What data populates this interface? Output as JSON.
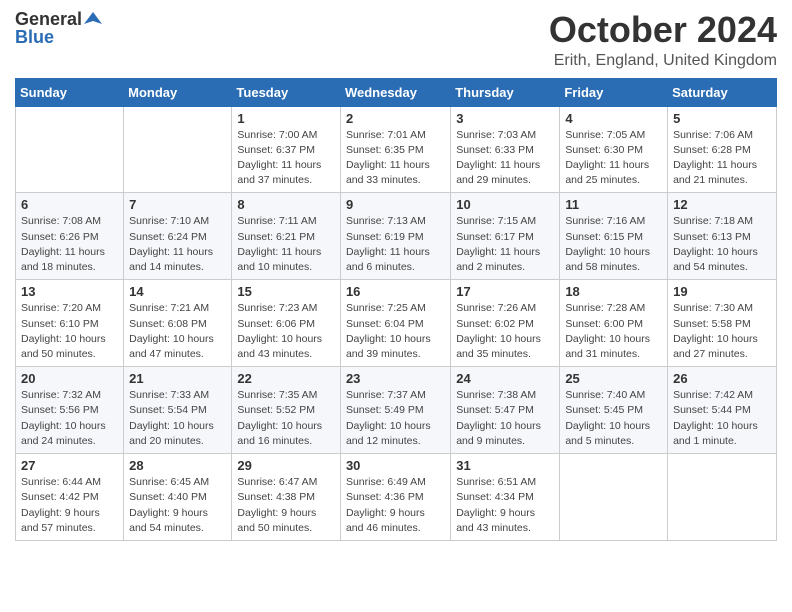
{
  "header": {
    "logo_general": "General",
    "logo_blue": "Blue",
    "month": "October 2024",
    "location": "Erith, England, United Kingdom"
  },
  "weekdays": [
    "Sunday",
    "Monday",
    "Tuesday",
    "Wednesday",
    "Thursday",
    "Friday",
    "Saturday"
  ],
  "weeks": [
    [
      {
        "day": "",
        "info": ""
      },
      {
        "day": "",
        "info": ""
      },
      {
        "day": "1",
        "info": "Sunrise: 7:00 AM\nSunset: 6:37 PM\nDaylight: 11 hours\nand 37 minutes."
      },
      {
        "day": "2",
        "info": "Sunrise: 7:01 AM\nSunset: 6:35 PM\nDaylight: 11 hours\nand 33 minutes."
      },
      {
        "day": "3",
        "info": "Sunrise: 7:03 AM\nSunset: 6:33 PM\nDaylight: 11 hours\nand 29 minutes."
      },
      {
        "day": "4",
        "info": "Sunrise: 7:05 AM\nSunset: 6:30 PM\nDaylight: 11 hours\nand 25 minutes."
      },
      {
        "day": "5",
        "info": "Sunrise: 7:06 AM\nSunset: 6:28 PM\nDaylight: 11 hours\nand 21 minutes."
      }
    ],
    [
      {
        "day": "6",
        "info": "Sunrise: 7:08 AM\nSunset: 6:26 PM\nDaylight: 11 hours\nand 18 minutes."
      },
      {
        "day": "7",
        "info": "Sunrise: 7:10 AM\nSunset: 6:24 PM\nDaylight: 11 hours\nand 14 minutes."
      },
      {
        "day": "8",
        "info": "Sunrise: 7:11 AM\nSunset: 6:21 PM\nDaylight: 11 hours\nand 10 minutes."
      },
      {
        "day": "9",
        "info": "Sunrise: 7:13 AM\nSunset: 6:19 PM\nDaylight: 11 hours\nand 6 minutes."
      },
      {
        "day": "10",
        "info": "Sunrise: 7:15 AM\nSunset: 6:17 PM\nDaylight: 11 hours\nand 2 minutes."
      },
      {
        "day": "11",
        "info": "Sunrise: 7:16 AM\nSunset: 6:15 PM\nDaylight: 10 hours\nand 58 minutes."
      },
      {
        "day": "12",
        "info": "Sunrise: 7:18 AM\nSunset: 6:13 PM\nDaylight: 10 hours\nand 54 minutes."
      }
    ],
    [
      {
        "day": "13",
        "info": "Sunrise: 7:20 AM\nSunset: 6:10 PM\nDaylight: 10 hours\nand 50 minutes."
      },
      {
        "day": "14",
        "info": "Sunrise: 7:21 AM\nSunset: 6:08 PM\nDaylight: 10 hours\nand 47 minutes."
      },
      {
        "day": "15",
        "info": "Sunrise: 7:23 AM\nSunset: 6:06 PM\nDaylight: 10 hours\nand 43 minutes."
      },
      {
        "day": "16",
        "info": "Sunrise: 7:25 AM\nSunset: 6:04 PM\nDaylight: 10 hours\nand 39 minutes."
      },
      {
        "day": "17",
        "info": "Sunrise: 7:26 AM\nSunset: 6:02 PM\nDaylight: 10 hours\nand 35 minutes."
      },
      {
        "day": "18",
        "info": "Sunrise: 7:28 AM\nSunset: 6:00 PM\nDaylight: 10 hours\nand 31 minutes."
      },
      {
        "day": "19",
        "info": "Sunrise: 7:30 AM\nSunset: 5:58 PM\nDaylight: 10 hours\nand 27 minutes."
      }
    ],
    [
      {
        "day": "20",
        "info": "Sunrise: 7:32 AM\nSunset: 5:56 PM\nDaylight: 10 hours\nand 24 minutes."
      },
      {
        "day": "21",
        "info": "Sunrise: 7:33 AM\nSunset: 5:54 PM\nDaylight: 10 hours\nand 20 minutes."
      },
      {
        "day": "22",
        "info": "Sunrise: 7:35 AM\nSunset: 5:52 PM\nDaylight: 10 hours\nand 16 minutes."
      },
      {
        "day": "23",
        "info": "Sunrise: 7:37 AM\nSunset: 5:49 PM\nDaylight: 10 hours\nand 12 minutes."
      },
      {
        "day": "24",
        "info": "Sunrise: 7:38 AM\nSunset: 5:47 PM\nDaylight: 10 hours\nand 9 minutes."
      },
      {
        "day": "25",
        "info": "Sunrise: 7:40 AM\nSunset: 5:45 PM\nDaylight: 10 hours\nand 5 minutes."
      },
      {
        "day": "26",
        "info": "Sunrise: 7:42 AM\nSunset: 5:44 PM\nDaylight: 10 hours\nand 1 minute."
      }
    ],
    [
      {
        "day": "27",
        "info": "Sunrise: 6:44 AM\nSunset: 4:42 PM\nDaylight: 9 hours\nand 57 minutes."
      },
      {
        "day": "28",
        "info": "Sunrise: 6:45 AM\nSunset: 4:40 PM\nDaylight: 9 hours\nand 54 minutes."
      },
      {
        "day": "29",
        "info": "Sunrise: 6:47 AM\nSunset: 4:38 PM\nDaylight: 9 hours\nand 50 minutes."
      },
      {
        "day": "30",
        "info": "Sunrise: 6:49 AM\nSunset: 4:36 PM\nDaylight: 9 hours\nand 46 minutes."
      },
      {
        "day": "31",
        "info": "Sunrise: 6:51 AM\nSunset: 4:34 PM\nDaylight: 9 hours\nand 43 minutes."
      },
      {
        "day": "",
        "info": ""
      },
      {
        "day": "",
        "info": ""
      }
    ]
  ]
}
